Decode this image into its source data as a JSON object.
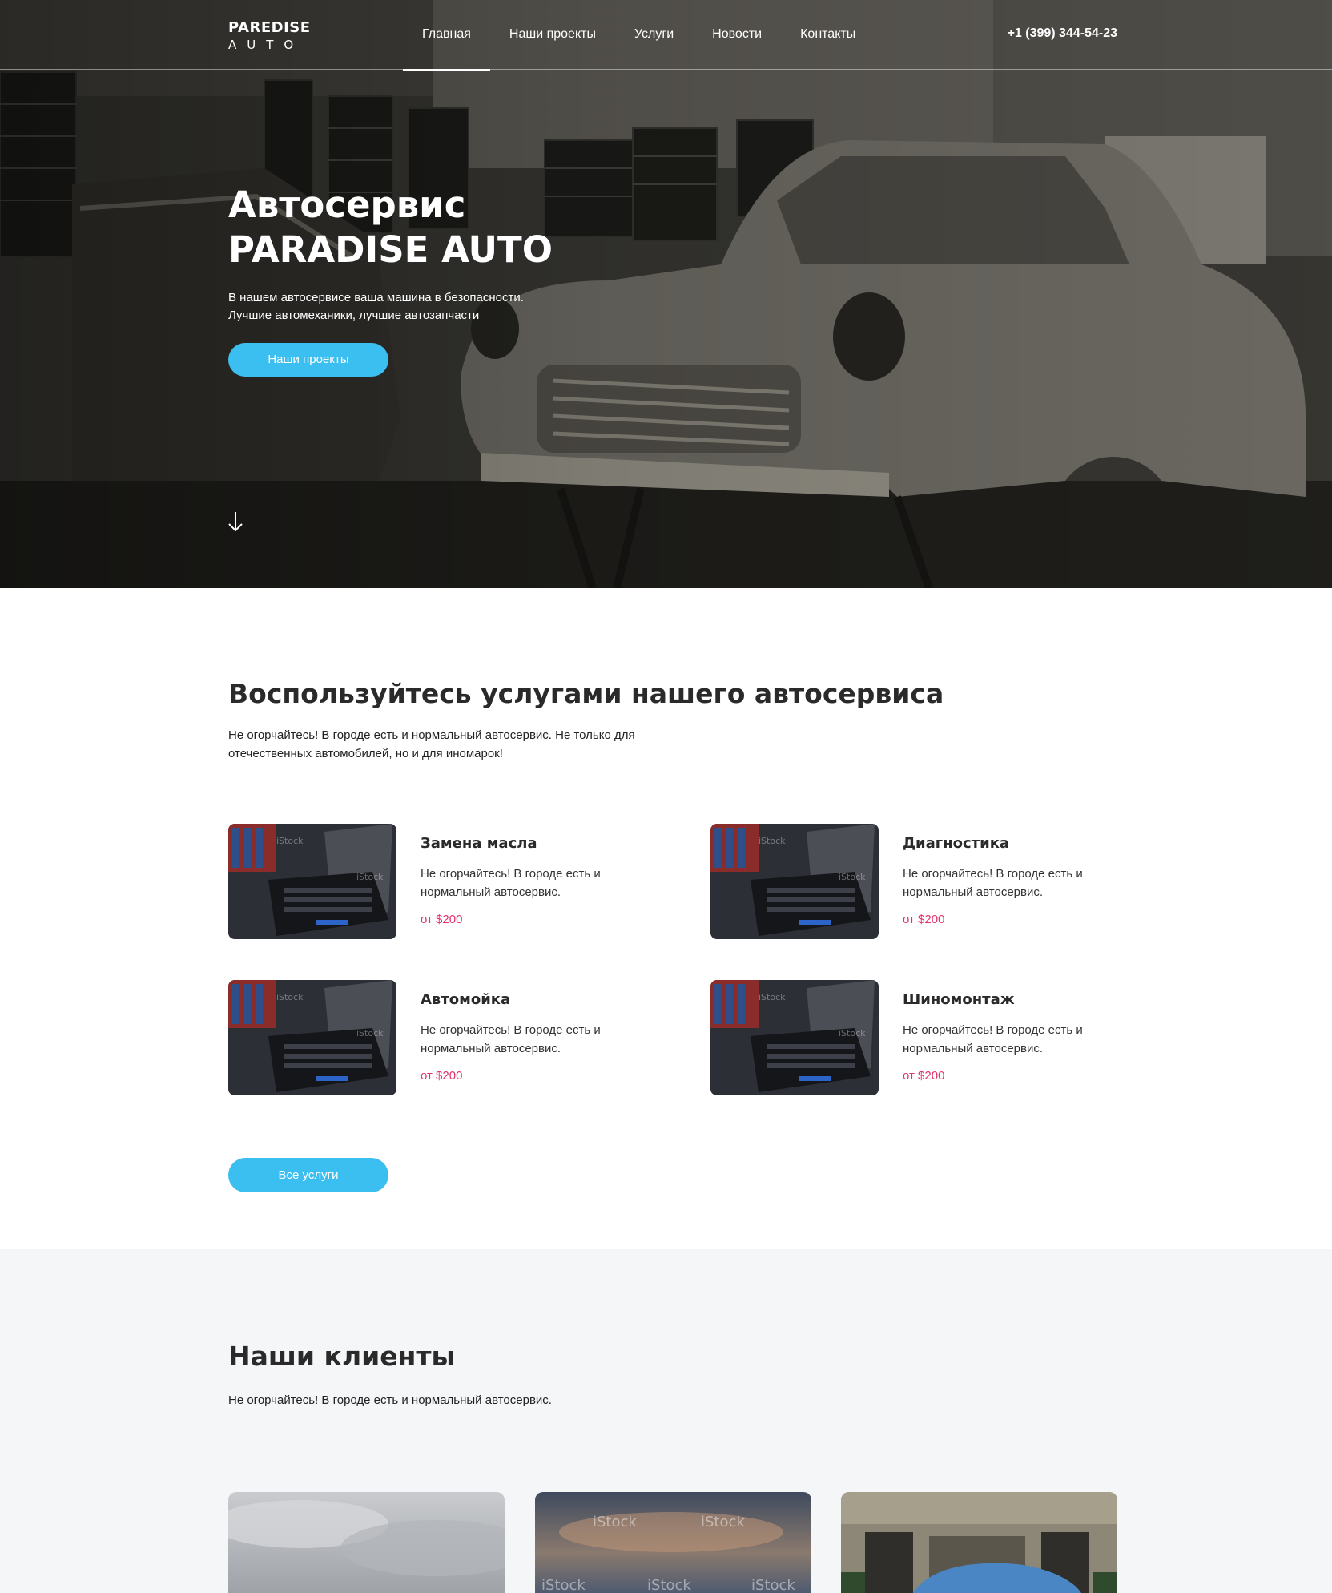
{
  "brand": {
    "logo_top": "PAREDISE",
    "logo_bottom": "AUTO"
  },
  "nav": {
    "items": [
      {
        "label": "Главная",
        "active": true
      },
      {
        "label": "Наши проекты"
      },
      {
        "label": "Услуги"
      },
      {
        "label": "Новости"
      },
      {
        "label": "Контакты"
      }
    ],
    "phone": "+1 (399) 344-54-23"
  },
  "hero": {
    "title_line1": "Автосервис",
    "title_line2": "PARADISE AUTO",
    "subtitle_line1": "В нашем автосервисе ваша машина в безопасности.",
    "subtitle_line2": "Лучшие автомеханики, лучшие автозапчасти",
    "button": "Наши проекты",
    "scroll_icon": "arrow-down-icon"
  },
  "services": {
    "title": "Воспользуйтесь услугами нашего автосервиса",
    "desc_line1": "Не огорчайтесь! В городе есть и нормальный автосервис. Не только для",
    "desc_line2": "отечественных автомобилей, но и для иномарок!",
    "items": [
      {
        "name": "Замена масла",
        "desc": "Не огорчайтесь! В городе есть и нормальный автосервис.",
        "price": "от $200"
      },
      {
        "name": "Диагностика",
        "desc": "Не огорчайтесь! В городе есть и нормальный автосервис.",
        "price": "от $200"
      },
      {
        "name": "Автомойка",
        "desc": "Не огорчайтесь! В городе есть и нормальный автосервис.",
        "price": "от $200"
      },
      {
        "name": "Шиномонтаж",
        "desc": "Не огорчайтесь! В городе есть и нормальный автосервис.",
        "price": "от $200"
      }
    ],
    "button": "Все услуги",
    "watermark": "iStock"
  },
  "clients": {
    "title": "Наши клиенты",
    "desc": "Не огорчайтесь! В городе есть и нормальный автосервис.",
    "watermark": "iStock"
  },
  "colors": {
    "accent": "#3bbef0",
    "price": "#e3336a",
    "section_bg": "#f5f6f8"
  }
}
